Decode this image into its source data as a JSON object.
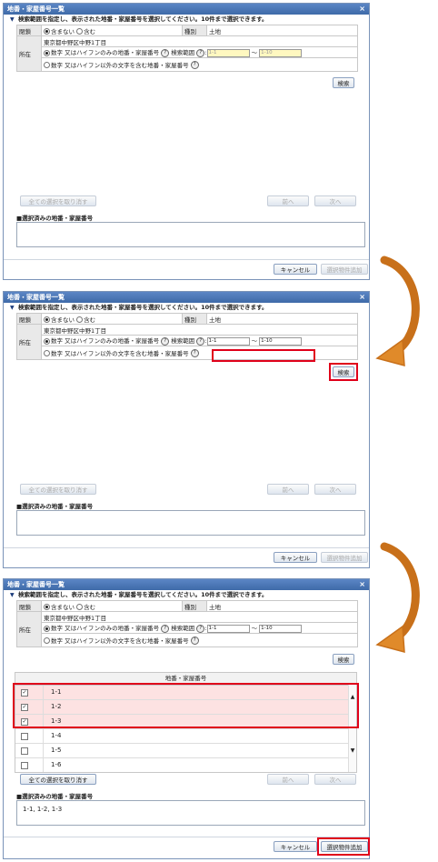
{
  "dialog": {
    "title": "地番・家屋番号一覧",
    "close": "×",
    "instruction": "検索範囲を指定し、表示された地番・家屋番号を選択してください。10件まで選択できます。",
    "closed_label": "閉鎖",
    "closed_opt1": "含まない",
    "closed_opt2": "含む",
    "kind_label": "種別",
    "kind_value": "土地",
    "address_value": "東京都中野区中野1丁目",
    "location_label": "所在",
    "opt_numeric": "数字 又はハイフンのみの地番・家屋番号",
    "search_range_label": "検索範囲",
    "range_sep": "～",
    "opt_other": "数字 又はハイフン以外の文字を含む地番・家屋番号",
    "search_btn": "検索",
    "clear_all_btn": "全ての選択を取り消す",
    "prev_btn": "前へ",
    "next_btn": "次へ",
    "selected_label": "■選択済みの地番・家屋番号",
    "cancel_btn": "キャンセル",
    "add_btn": "選択物件追加",
    "help": "?",
    "tri": "▼"
  },
  "step1": {
    "range_from": "1-1",
    "range_to": "1-10",
    "selected_text": ""
  },
  "step2": {
    "range_from": "1-1",
    "range_to": "1-10",
    "selected_text": ""
  },
  "step3": {
    "range_from": "1-1",
    "range_to": "1-10",
    "grid_header": "地番・家屋番号",
    "rows": [
      {
        "value": "1-1",
        "checked": "✓"
      },
      {
        "value": "1-2",
        "checked": "✓"
      },
      {
        "value": "1-3",
        "checked": "✓"
      },
      {
        "value": "1-4",
        "checked": ""
      },
      {
        "value": "1-5",
        "checked": ""
      },
      {
        "value": "1-6",
        "checked": ""
      }
    ],
    "selected_text": "1-1, 1-2, 1-3"
  },
  "colors": {
    "highlight": "#e0001a",
    "arrow": "#c8701a"
  }
}
